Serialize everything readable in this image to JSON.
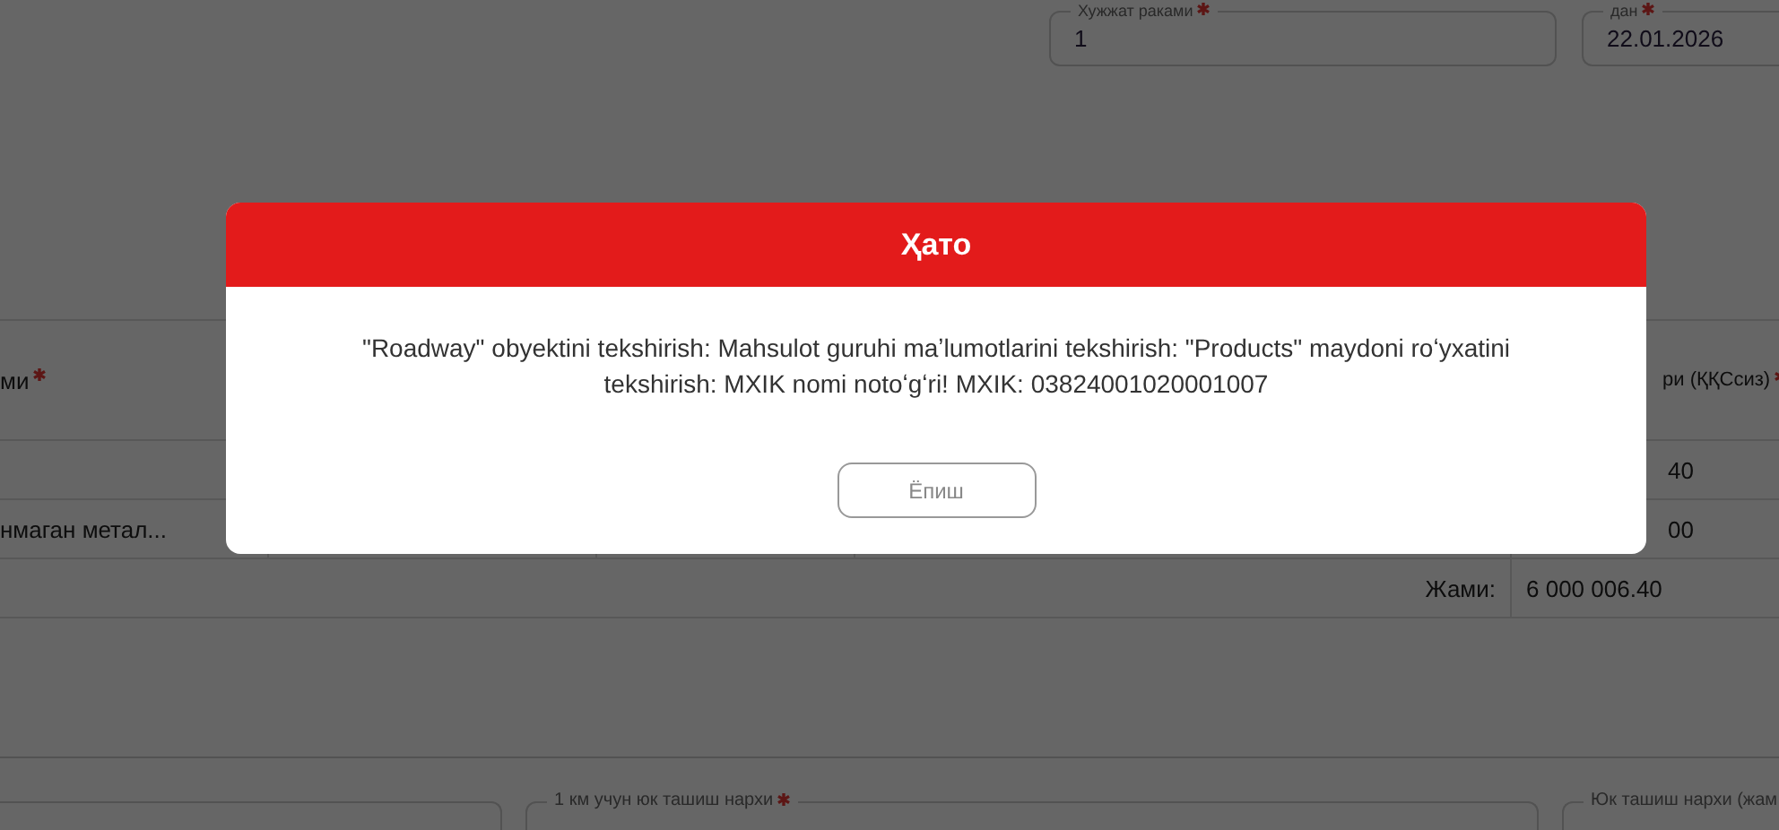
{
  "header_fields": [
    {
      "label": "Хужжат раками",
      "required": true,
      "value": "1"
    },
    {
      "label": "дан",
      "required": true,
      "value": "22.01.2026"
    }
  ],
  "table": {
    "columns": [
      {
        "label": "ми",
        "required": true
      },
      {
        "label": "ри (ҚҚСсиз)",
        "required": true
      }
    ],
    "rows": [
      {
        "column_5": "40"
      },
      {
        "column_1": "нмаган метал...",
        "column_5": "00"
      }
    ],
    "total": {
      "label": "Жами:",
      "value": "6 000 006.40"
    }
  },
  "bottom_fields": [
    {
      "label": "1 км учун юк ташиш нархи",
      "required": true
    },
    {
      "label": "Юк ташиш нархи (жам"
    }
  ],
  "modal": {
    "title": "Ҳато",
    "message": "\"Roadway\" obyektini tekshirish: Mahsulot guruhi maʼlumotlarini tekshirish: \"Products\" maydoni roʻyxatini tekshirish: MXIK nomi notoʻgʻri! MXIK: 03824001020001007",
    "buttons": [
      {
        "label": "Ёпиш"
      }
    ]
  }
}
